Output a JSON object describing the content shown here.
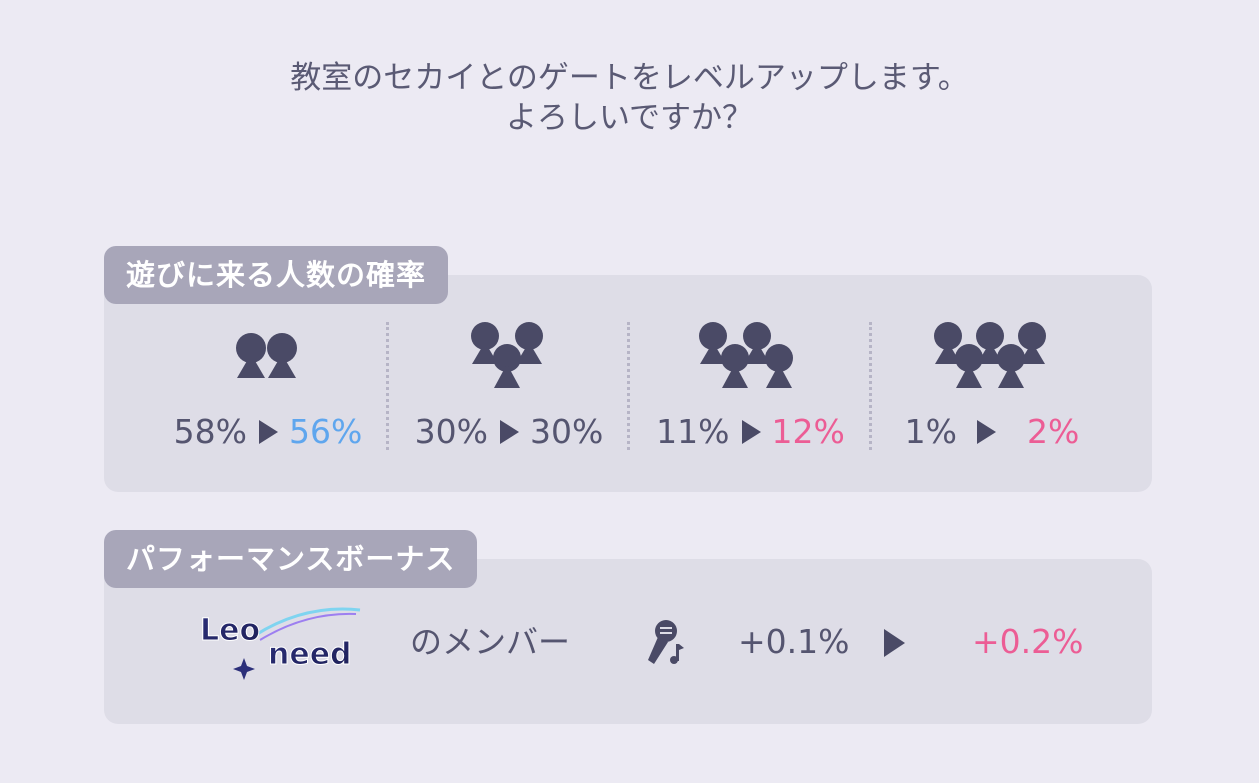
{
  "dialog": {
    "message_line1": "教室のセカイとのゲートをレベルアップします。",
    "message_line2": "よろしいですか？"
  },
  "visitors": {
    "section_label": "遊びに来る人数の確率",
    "columns": [
      {
        "people": 2,
        "from": "58%",
        "to": "56%",
        "change": "down",
        "to_color": "#5fa6ee"
      },
      {
        "people": 3,
        "from": "30%",
        "to": "30%",
        "change": "same",
        "to_color": "#555570"
      },
      {
        "people": 4,
        "from": "11%",
        "to": "12%",
        "change": "up",
        "to_color": "#ec5d95"
      },
      {
        "people": 5,
        "from": "1%",
        "to": "2%",
        "change": "up",
        "to_color": "#ec5d95"
      }
    ]
  },
  "bonus": {
    "section_label": "パフォーマンスボーナス",
    "unit_logo_text": "Leo/need",
    "member_label": "のメンバー",
    "icon": "microphone-icon",
    "from": "+0.1%",
    "to": "+0.2%",
    "to_color": "#ec5d95"
  },
  "colors": {
    "background": "#eceaf3",
    "panel": "#dedde7",
    "label_bg": "#a8a6b9",
    "text": "#555570",
    "decrease": "#5fa6ee",
    "increase": "#ec5d95"
  }
}
